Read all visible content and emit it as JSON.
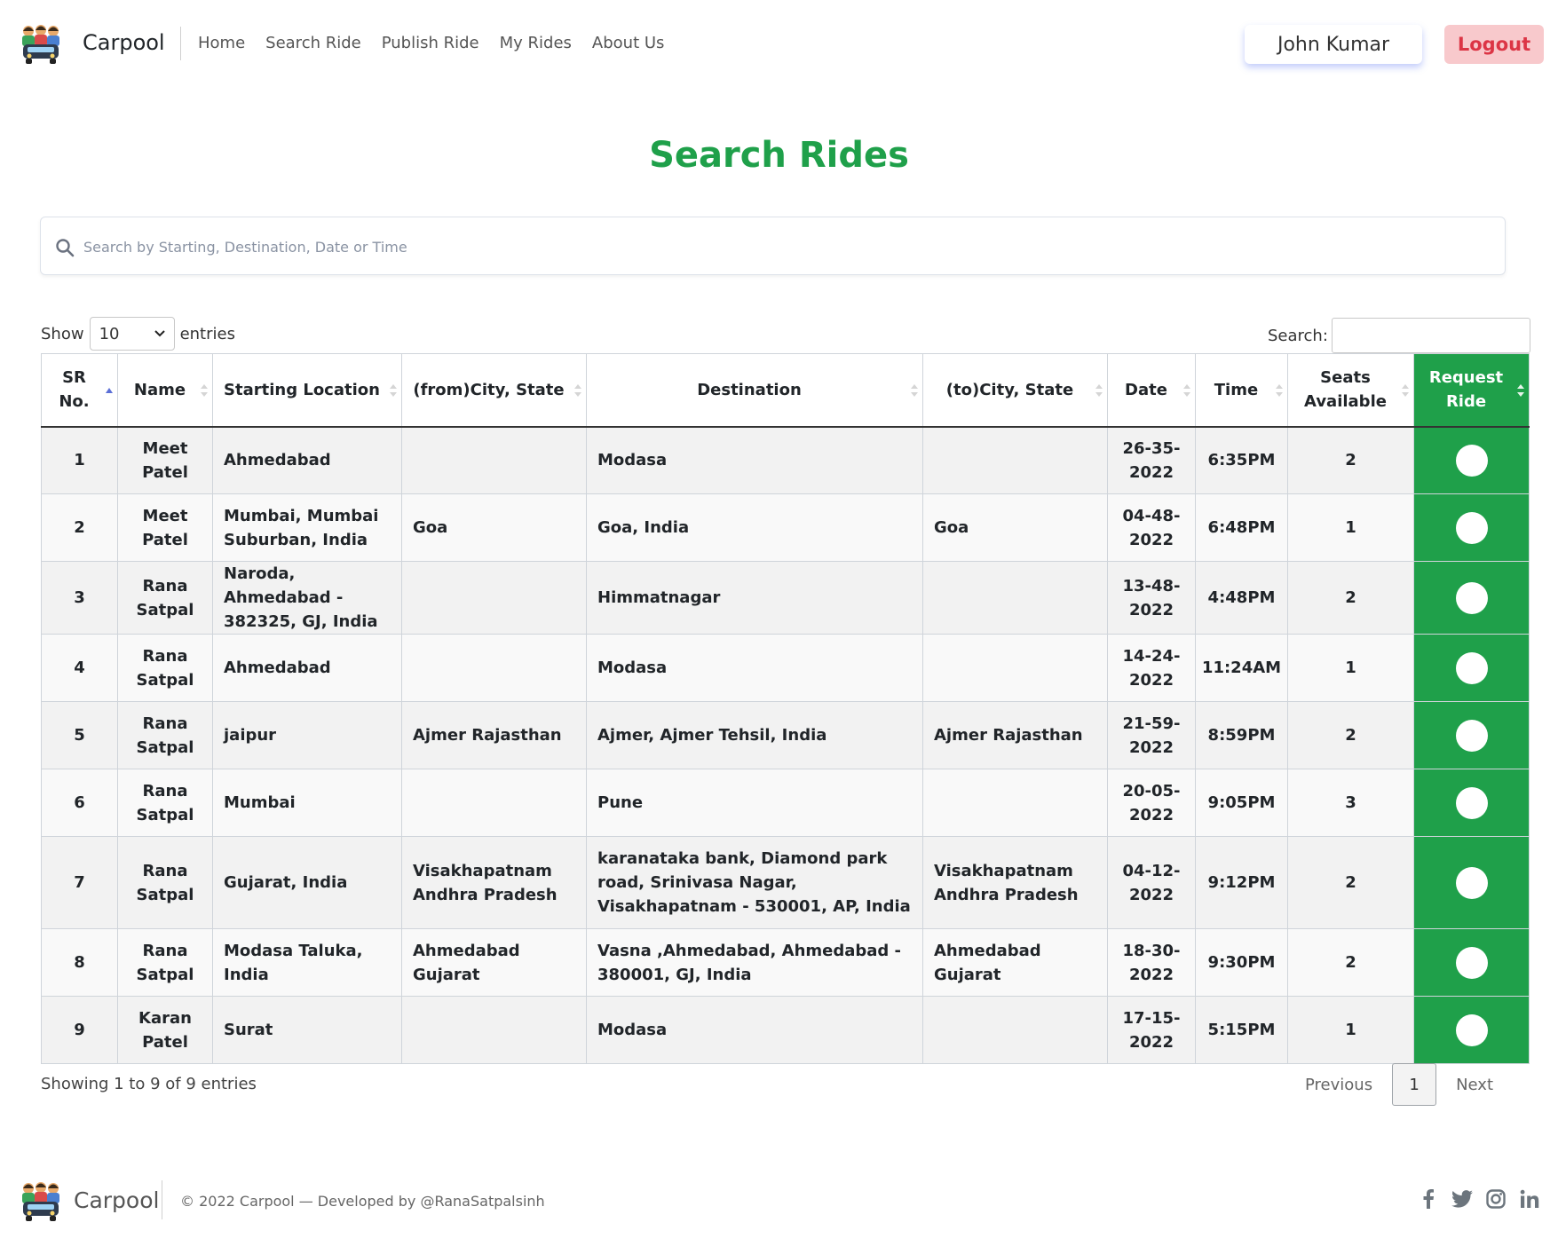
{
  "nav": {
    "brand": "Carpool",
    "links": [
      "Home",
      "Search Ride",
      "Publish Ride",
      "My Rides",
      "About Us"
    ],
    "user_name": "John Kumar",
    "logout_label": "Logout"
  },
  "page": {
    "title": "Search Rides",
    "search_placeholder": "Search by Starting, Destination, Date or Time"
  },
  "table_controls": {
    "show_label": "Show",
    "entries_value": "10",
    "entries_label": "entries",
    "search_label": "Search:"
  },
  "table": {
    "headers": [
      "SR No.",
      "Name",
      "Starting Location",
      "(from)City, State",
      "Destination",
      "(to)City, State",
      "Date",
      "Time",
      "Seats Available",
      "Request Ride"
    ],
    "rows": [
      {
        "sr": "1",
        "name": "Meet Patel",
        "start": "Ahmedabad",
        "from_city": "",
        "destination": "Modasa",
        "to_city": "",
        "date": "26-35-2022",
        "time": "6:35PM",
        "seats": "2"
      },
      {
        "sr": "2",
        "name": "Meet Patel",
        "start": "Mumbai, Mumbai Suburban, India",
        "from_city": "Goa",
        "destination": "Goa, India",
        "to_city": "Goa",
        "date": "04-48-2022",
        "time": "6:48PM",
        "seats": "1"
      },
      {
        "sr": "3",
        "name": "Rana Satpal",
        "start": "Naroda, Ahmedabad - 382325, GJ, India",
        "from_city": "",
        "destination": "Himmatnagar",
        "to_city": "",
        "date": "13-48-2022",
        "time": "4:48PM",
        "seats": "2"
      },
      {
        "sr": "4",
        "name": "Rana Satpal",
        "start": "Ahmedabad",
        "from_city": "",
        "destination": "Modasa",
        "to_city": "",
        "date": "14-24-2022",
        "time": "11:24AM",
        "seats": "1"
      },
      {
        "sr": "5",
        "name": "Rana Satpal",
        "start": "jaipur",
        "from_city": "Ajmer Rajasthan",
        "destination": "Ajmer, Ajmer Tehsil, India",
        "to_city": "Ajmer Rajasthan",
        "date": "21-59-2022",
        "time": "8:59PM",
        "seats": "2"
      },
      {
        "sr": "6",
        "name": "Rana Satpal",
        "start": "Mumbai",
        "from_city": "",
        "destination": "Pune",
        "to_city": "",
        "date": "20-05-2022",
        "time": "9:05PM",
        "seats": "3"
      },
      {
        "sr": "7",
        "name": "Rana Satpal",
        "start": "Gujarat, India",
        "from_city": "Visakhapatnam Andhra Pradesh",
        "destination": "karanataka bank, Diamond park road, Srinivasa Nagar, Visakhapatnam - 530001, AP, India",
        "to_city": "Visakhapatnam Andhra Pradesh",
        "date": "04-12-2022",
        "time": "9:12PM",
        "seats": "2"
      },
      {
        "sr": "8",
        "name": "Rana Satpal",
        "start": "Modasa Taluka, India",
        "from_city": "Ahmedabad Gujarat",
        "destination": "Vasna ,Ahmedabad, Ahmedabad - 380001, GJ, India",
        "to_city": "Ahmedabad Gujarat",
        "date": "18-30-2022",
        "time": "9:30PM",
        "seats": "2"
      },
      {
        "sr": "9",
        "name": "Karan Patel",
        "start": "Surat",
        "from_city": "",
        "destination": "Modasa",
        "to_city": "",
        "date": "17-15-2022",
        "time": "5:15PM",
        "seats": "1"
      }
    ]
  },
  "info": {
    "text": "Showing 1 to 9 of 9 entries"
  },
  "pagination": {
    "previous": "Previous",
    "current": "1",
    "next": "Next"
  },
  "footer": {
    "brand": "Carpool",
    "copyright": "© 2022 Carpool —  Developed by @RanaSatpalsinh",
    "social_icons": [
      "facebook-icon",
      "twitter-icon",
      "instagram-icon",
      "linkedin-icon"
    ]
  },
  "colors": {
    "accent_green": "#1fa04a",
    "logout_bg": "#f8c9cc",
    "logout_text": "#dc3545",
    "sort_active": "#5b6fd6"
  }
}
